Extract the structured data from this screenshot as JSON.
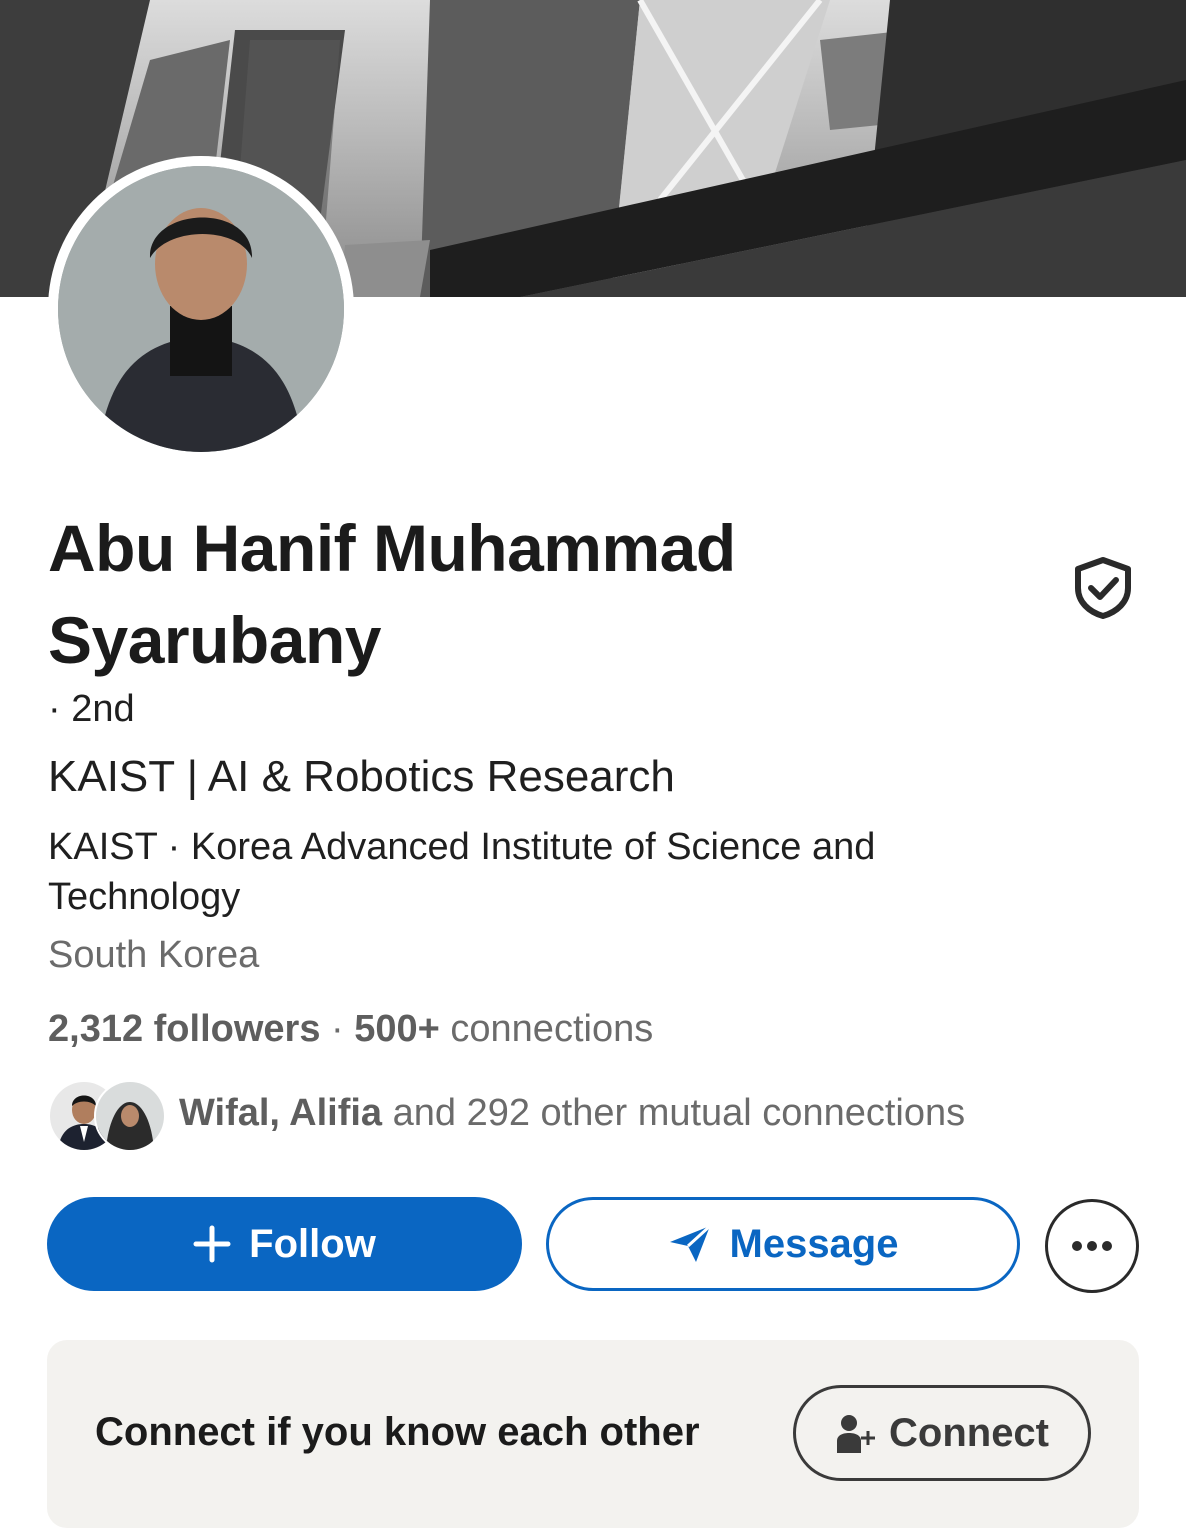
{
  "profile": {
    "name": "Abu Hanif Muhammad Syarubany",
    "degree": "· 2nd",
    "headline": "KAIST | AI & Robotics Research",
    "education": "KAIST · Korea Advanced Institute of Science and Technology",
    "location": "South Korea"
  },
  "stats": {
    "followers": "2,312 followers",
    "separator": "·",
    "connections_count": "500+",
    "connections_label": "connections"
  },
  "mutual": {
    "names": "Wifal, Alifia",
    "rest": "and 292 other mutual connections"
  },
  "actions": {
    "follow_label": "Follow",
    "message_label": "Message"
  },
  "connect_card": {
    "text": "Connect if you know each other",
    "button_label": "Connect"
  },
  "colors": {
    "primary": "#0a66c2",
    "card_bg": "#f3f2ef",
    "muted_text": "#6b6b6b"
  },
  "icons": [
    "verified-shield-icon",
    "plus-icon",
    "send-icon",
    "more-dots-icon",
    "add-person-icon"
  ]
}
